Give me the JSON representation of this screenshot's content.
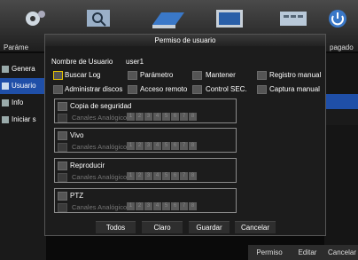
{
  "toolbar": {
    "items": [
      {
        "icon": "gear-icon"
      },
      {
        "icon": "search-icon"
      },
      {
        "icon": "hdd-icon"
      },
      {
        "icon": "monitor-icon"
      },
      {
        "icon": "keyboard-icon"
      },
      {
        "icon": "power-icon"
      }
    ],
    "left_label": "Paráme",
    "right_label": "pagado"
  },
  "sidebar": {
    "items": [
      {
        "label": "Genera",
        "icon": "gear-icon"
      },
      {
        "label": "Usuario",
        "icon": "user-icon"
      },
      {
        "label": "Info",
        "icon": "info-icon"
      },
      {
        "label": "Iniciar s",
        "icon": "login-icon"
      }
    ],
    "active": "Usuario"
  },
  "bottombar": {
    "permiso": "Permiso",
    "editar": "Editar",
    "cancelar": "Cancelar"
  },
  "dialog": {
    "title": "Permiso de usuario",
    "username_label": "Nombre de Usuario",
    "username_value": "user1",
    "permissions": {
      "buscar_log": "Buscar Log",
      "parametro": "Parámetro",
      "mantener": "Mantener",
      "registro_manual": "Registro manual",
      "administrar_discos": "Administrar discos",
      "acceso_remoto": "Acceso remoto",
      "control_sec": "Control SEC.",
      "captura_manual": "Captura manual"
    },
    "groups": [
      {
        "title": "Copia de seguridad",
        "sub": "Canales Analógicos"
      },
      {
        "title": "Vivo",
        "sub": "Canales Analógicos"
      },
      {
        "title": "Reproducir",
        "sub": "Canales Analógicos"
      },
      {
        "title": "PTZ",
        "sub": "Canales Analógicos"
      }
    ],
    "channels": [
      "1",
      "2",
      "3",
      "4",
      "5",
      "6",
      "7",
      "8"
    ],
    "buttons": {
      "todos": "Todos",
      "claro": "Claro",
      "guardar": "Guardar",
      "cancelar": "Cancelar"
    }
  },
  "colors": {
    "accent": "#1f4fa8",
    "focus": "#e8c400"
  }
}
